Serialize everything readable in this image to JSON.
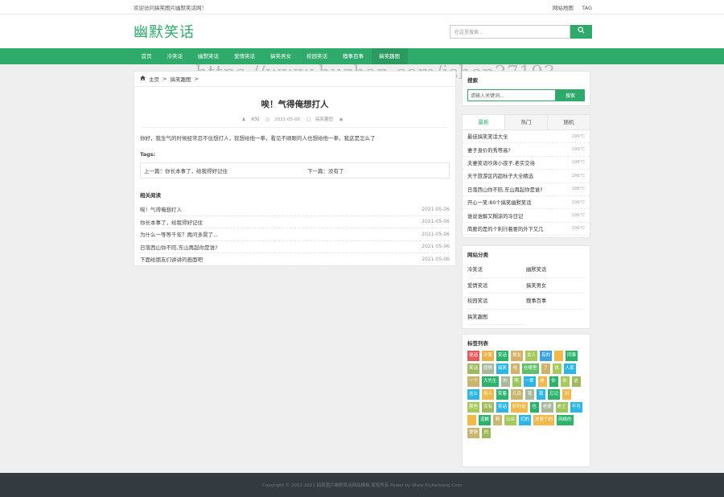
{
  "topbar": {
    "welcome": "欢迎访问搞笑图片幽默笑话网！",
    "links": [
      "网站地图",
      "TAG"
    ]
  },
  "header": {
    "logo": "幽默笑话",
    "search_placeholder": "在这里搜索...",
    "search_icon": "search-icon"
  },
  "nav": {
    "items": [
      "首页",
      "冷笑话",
      "幽默笑话",
      "爱情笑话",
      "搞笑男女",
      "校园笑话",
      "糗事百事",
      "搞笑趣图"
    ],
    "active_index": 7
  },
  "watermark": "https://www.huzhan.com/ishop27193",
  "article": {
    "breadcrumb": [
      "主页",
      ">",
      "搞笑趣图",
      ">"
    ],
    "title": "唉！气得俺想打人",
    "meta": {
      "author": "未知",
      "date": "2021-05-06",
      "category": "搞笑趣图",
      "views": ""
    },
    "body": "你好，我生气的时候经常忍不住想打人，就想给他一拳，看见不顺眼的人也想给他一拳，我这是怎么了",
    "tags_label": "Tags:",
    "prev": "上一篇：你长本事了，给我得好记住",
    "next": "下一篇：没有了",
    "related_heading": "相关阅读",
    "related": [
      {
        "title": "唉！气得俺想打人",
        "date": "2021-05-06"
      },
      {
        "title": "你长本事了，给我得好记住",
        "date": "2021-05-06"
      },
      {
        "title": "为什么一等等千年？再问多晃了...",
        "date": "2021-05-06"
      },
      {
        "title": "日落西山你不陪,东山再起你是谁?",
        "date": "2021-05-06"
      },
      {
        "title": "下面给朋友们讲讲的画面吧",
        "date": "2021-05-06"
      }
    ]
  },
  "sidebar": {
    "search_heading": "搜索",
    "search_value": "请输入关键词...",
    "search_button": "搜索",
    "tabs": [
      "最新",
      "热门",
      "随机"
    ],
    "active_tab": 0,
    "hot": [
      {
        "title": "最佳搞笑笑话大全",
        "temp": "199℃"
      },
      {
        "title": "妻子身价的秀等高?",
        "temp": "199℃"
      },
      {
        "title": "夫妻笑话吵床小孩子,老实交待",
        "temp": "198℃"
      },
      {
        "title": "天干旅游区内超标子大全精选",
        "temp": "198℃"
      },
      {
        "title": "日落西山你不陪,东山再起你是谁?",
        "temp": "198℃"
      },
      {
        "title": "开心一笑:80个搞笑幽默笑话",
        "temp": "196℃"
      },
      {
        "title": "谁说谁解又糊涂的冷日记",
        "temp": "196℃"
      },
      {
        "title": "简要的是的个利行着要的外下又几",
        "temp": "196℃"
      }
    ],
    "categories_heading": "网站分类",
    "categories": [
      "冷笑话",
      "幽默笑话",
      "爱情笑话",
      "搞笑男女",
      "校园笑话",
      "糗事百事",
      "搞笑趣图"
    ],
    "tags_heading": "标签列表",
    "tags": [
      {
        "t": "说话",
        "c": "#e55b5b"
      },
      {
        "t": "冷笑",
        "c": "#e9b243"
      },
      {
        "t": "笑话",
        "c": "#29b36b"
      },
      {
        "t": "男女",
        "c": "#d6b069"
      },
      {
        "t": "女人",
        "c": "#a6c95a"
      },
      {
        "t": "有的",
        "c": "#3aa4e0"
      },
      {
        "t": "",
        "c": "#f2b84a"
      },
      {
        "t": "同事",
        "c": "#29b36b"
      },
      {
        "t": "笑话",
        "c": "#9dbb5a"
      },
      {
        "t": "感情",
        "c": "#a9b89a"
      },
      {
        "t": "搞笑",
        "c": "#2ab7e8"
      },
      {
        "t": "吃",
        "c": "#d1b36c"
      },
      {
        "t": "在哪里",
        "c": "#5fbf6a"
      },
      {
        "t": "了",
        "c": "#cdb26a"
      },
      {
        "t": "说",
        "c": "#a6c95a"
      },
      {
        "t": "人家",
        "c": "#2ab7e8"
      },
      {
        "t": "一个",
        "c": "#c9b56d"
      },
      {
        "t": "大先生",
        "c": "#29b36b"
      },
      {
        "t": "的",
        "c": "#a9b89a"
      },
      {
        "t": "啊",
        "c": "#9cc65b"
      },
      {
        "t": "一辈",
        "c": "#2ab7e8"
      },
      {
        "t": "是",
        "c": "#f2b84a"
      },
      {
        "t": "你",
        "c": "#29b36b"
      },
      {
        "t": "你",
        "c": "#a6c95a"
      },
      {
        "t": "这",
        "c": "#9dbb5a"
      },
      {
        "t": "这么",
        "c": "#2ab7e8"
      },
      {
        "t": "男人",
        "c": "#f2b84a"
      },
      {
        "t": "笑着",
        "c": "#29b36b"
      },
      {
        "t": "几百",
        "c": "#c9b56d"
      },
      {
        "t": "我",
        "c": "#a9b89a"
      },
      {
        "t": "我",
        "c": "#2ab7e8"
      },
      {
        "t": "忘记",
        "c": "#29b36b"
      },
      {
        "t": "对",
        "c": "#f2b84a"
      },
      {
        "t": "那些",
        "c": "#a6c95a"
      },
      {
        "t": "没有",
        "c": "#9dbb5a"
      },
      {
        "t": "笑话",
        "c": "#2ab7e8"
      },
      {
        "t": "妙的话",
        "c": "#f2b84a"
      },
      {
        "t": "也",
        "c": "#29b36b"
      },
      {
        "t": "老婆",
        "c": "#a9b89a"
      },
      {
        "t": "老王",
        "c": "#9cc65b"
      },
      {
        "t": "不可",
        "c": "#2ab7e8"
      },
      {
        "t": "",
        "c": "#f2b84a"
      },
      {
        "t": "道歉",
        "c": "#29b36b"
      },
      {
        "t": "啊",
        "c": "#c9b56d"
      },
      {
        "t": "公众",
        "c": "#a6c95a"
      },
      {
        "t": "们的",
        "c": "#2ab7e8"
      },
      {
        "t": "这是个的",
        "c": "#f2b84a"
      },
      {
        "t": "网络的",
        "c": "#29b36b"
      },
      {
        "t": "爱情",
        "c": "#c9b56d"
      },
      {
        "t": "的",
        "c": "#9dbb5a"
      }
    ]
  },
  "footer": "Copyright © 2002-2021 搞笑图片幽默笑话网站模板 版权所有 Power by Www.Xiuhaiwang.Com"
}
